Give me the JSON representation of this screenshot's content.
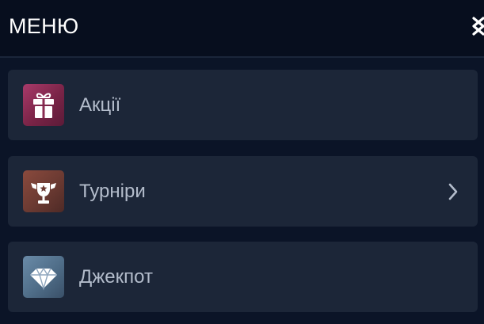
{
  "header": {
    "title": "МЕНЮ",
    "close_icon": "close-icon"
  },
  "items": [
    {
      "label": "Акції",
      "icon": "gift-icon",
      "has_chevron": false
    },
    {
      "label": "Турніри",
      "icon": "trophy-icon",
      "has_chevron": true
    },
    {
      "label": "Джекпот",
      "icon": "diamond-icon",
      "has_chevron": false
    }
  ],
  "colors": {
    "background": "#0b1427",
    "header_background": "#070e1e",
    "item_background": "#1c2638",
    "label_text": "#b3bccb",
    "title_text": "#ffffff"
  }
}
